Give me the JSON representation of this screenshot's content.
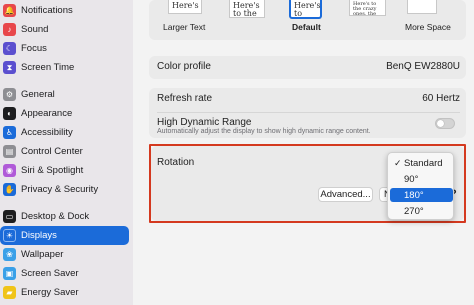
{
  "sidebar": {
    "items": [
      {
        "label": "Notifications",
        "icon": "bell-icon",
        "color": "#e8474b",
        "glyph": "🔔"
      },
      {
        "label": "Sound",
        "icon": "speaker-icon",
        "color": "#e8474b",
        "glyph": "♪"
      },
      {
        "label": "Focus",
        "icon": "moon-icon",
        "color": "#5b4fcf",
        "glyph": "☾"
      },
      {
        "label": "Screen Time",
        "icon": "hourglass-icon",
        "color": "#5b4fcf",
        "glyph": "⧗"
      },
      {
        "label": "General",
        "icon": "gear-icon",
        "color": "#8e8e93",
        "glyph": "⚙"
      },
      {
        "label": "Appearance",
        "icon": "appearance-icon",
        "color": "#1d1d1f",
        "glyph": "◐"
      },
      {
        "label": "Accessibility",
        "icon": "accessibility-icon",
        "color": "#1b6bd9",
        "glyph": "♿"
      },
      {
        "label": "Control Center",
        "icon": "control-center-icon",
        "color": "#8e8e93",
        "glyph": "▤"
      },
      {
        "label": "Siri & Spotlight",
        "icon": "siri-icon",
        "color": "#b05ad8",
        "glyph": "◉"
      },
      {
        "label": "Privacy & Security",
        "icon": "hand-icon",
        "color": "#1b6bd9",
        "glyph": "✋"
      },
      {
        "label": "Desktop & Dock",
        "icon": "dock-icon",
        "color": "#1d1d1f",
        "glyph": "▭"
      },
      {
        "label": "Displays",
        "icon": "sun-icon",
        "color": "#1b6bd9",
        "glyph": "☀"
      },
      {
        "label": "Wallpaper",
        "icon": "wallpaper-icon",
        "color": "#3aa0e8",
        "glyph": "❀"
      },
      {
        "label": "Screen Saver",
        "icon": "screen-saver-icon",
        "color": "#3aa0e8",
        "glyph": "▣"
      },
      {
        "label": "Energy Saver",
        "icon": "battery-icon",
        "color": "#f0c419",
        "glyph": "▰"
      }
    ],
    "active_label": "Displays"
  },
  "resolution": {
    "thumb1": "Here's",
    "thumb2": "Here's to the troublem",
    "thumb3": "Here's to the troublema ones.",
    "thumb4": "Here's to the crazy ones, the misfits, the rebels,",
    "label_left": "Larger Text",
    "label_mid": "Default",
    "label_right": "More Space"
  },
  "color_profile": {
    "label": "Color profile",
    "value": "BenQ EW2880U"
  },
  "refresh_rate": {
    "label": "Refresh rate",
    "value": "60 Hertz"
  },
  "hdr": {
    "label": "High Dynamic Range",
    "description": "Automatically adjust the display to show high dynamic range content."
  },
  "rotation": {
    "label": "Rotation",
    "advanced_label": "Advanced...",
    "behind_button_text": "N",
    "help_label": "?",
    "options": [
      "Standard",
      "90°",
      "180°",
      "270°"
    ],
    "checked_option": "Standard",
    "highlighted_option": "180°",
    "checkmark": "✓"
  },
  "colors": {
    "accent": "#1b6bd9",
    "highlight_box": "#d4391f"
  }
}
